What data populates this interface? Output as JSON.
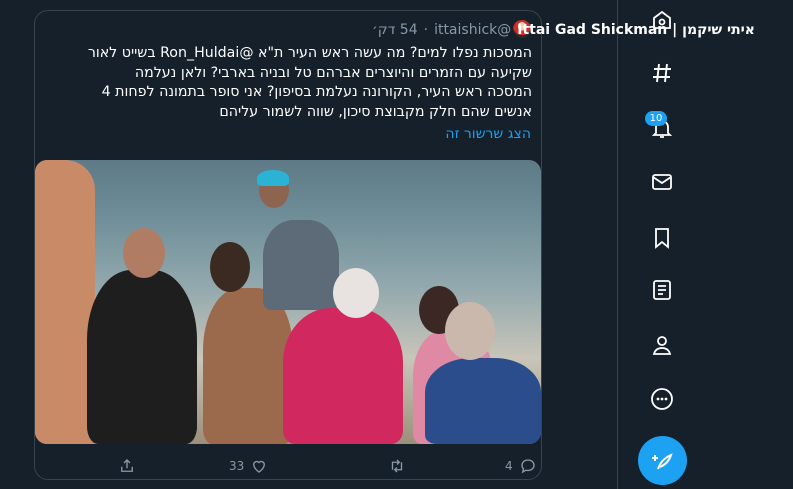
{
  "tweet": {
    "display_name": "איתי שיקמן | Ittai Gad Shickman",
    "handle": "@ittaishick",
    "dot": "·",
    "time": "54 דק׳",
    "text": "המסכות נפלו למים? מה עשה ראש העיר ת\"א @Ron_Huldai בשייט לאור\nשקיעה עם הזמרים והיוצרים אברהם טל ובניה בארבי? ולאן נעלמה\nהמסכה ראש העיר, הקורונה נעלמת בסיפון? אני סופר בתמונה לפחות 4\nאנשים שהם חלק מקבוצת סיכון, שווה לשמור עליהם",
    "show_thread": "הצג שרשור זה",
    "replies": "4",
    "likes": "33"
  },
  "sidebar": {
    "notifications_badge": "10",
    "items": [
      "home-icon",
      "explore-icon",
      "notifications-icon",
      "messages-icon",
      "bookmarks-icon",
      "lists-icon",
      "profile-icon",
      "more-icon"
    ]
  },
  "colors": {
    "background": "#15202b",
    "accent": "#1da1f2",
    "border": "#38444d",
    "muted": "#8899a6"
  }
}
